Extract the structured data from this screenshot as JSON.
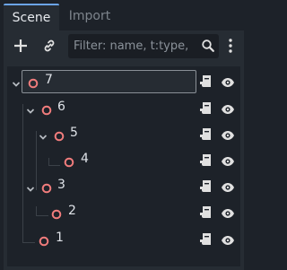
{
  "tabs": {
    "scene": "Scene",
    "import": "Import"
  },
  "toolbar": {
    "filter_placeholder": "Filter: name, t:type,"
  },
  "tree": {
    "nodes": [
      {
        "label": "7"
      },
      {
        "label": "6"
      },
      {
        "label": "5"
      },
      {
        "label": "4"
      },
      {
        "label": "3"
      },
      {
        "label": "2"
      },
      {
        "label": "1"
      }
    ]
  },
  "colors": {
    "node_icon": "#f07c7c",
    "accent": "#6ba4e6"
  }
}
